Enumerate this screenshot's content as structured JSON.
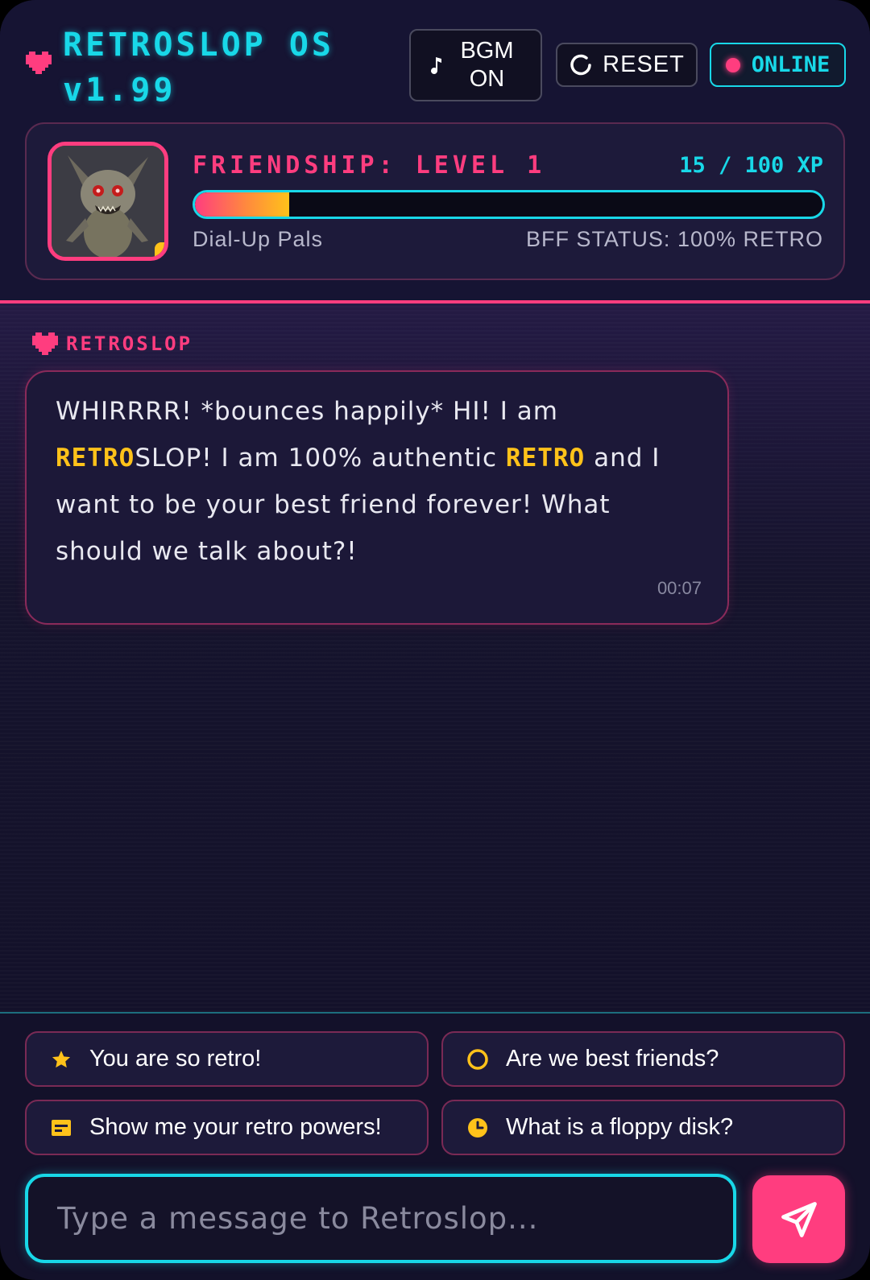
{
  "header": {
    "title_line1": "RETROSLOP OS",
    "title_line2": "v1.99",
    "bgm_label_line1": "BGM",
    "bgm_label_line2": "ON",
    "reset_label": "RESET",
    "status_label": "ONLINE"
  },
  "profile": {
    "friendship_label": "FRIENDSHIP: LEVEL 1",
    "xp_text": "15 / 100 XP",
    "xp_current": 15,
    "xp_max": 100,
    "group_label": "Dial-Up Pals",
    "bff_status": "BFF STATUS: 100% RETRO"
  },
  "chat": {
    "sender": "RETROSLOP",
    "message": {
      "part1": "WHIRRRR! *bounces happily* HI! I am ",
      "hl1": "RETRO",
      "part2": "SLOP! I am 100% authentic ",
      "hl2": "RETRO",
      "part3": " and I want to be your best friend forever! What should we talk about?!"
    },
    "timestamp": "00:07"
  },
  "quick_replies": [
    {
      "label": "You are so retro!",
      "icon": "star-icon"
    },
    {
      "label": "Are we best friends?",
      "icon": "circle-icon"
    },
    {
      "label": "Show me your retro powers!",
      "icon": "card-icon"
    },
    {
      "label": "What is a floppy disk?",
      "icon": "clock-icon"
    }
  ],
  "composer": {
    "placeholder": "Type a message to Retroslop...",
    "send_icon": "send-icon"
  },
  "colors": {
    "accent_pink": "#ff3d7f",
    "accent_cyan": "#18d8e8",
    "accent_yellow": "#ffc21a",
    "background": "#13112a"
  }
}
